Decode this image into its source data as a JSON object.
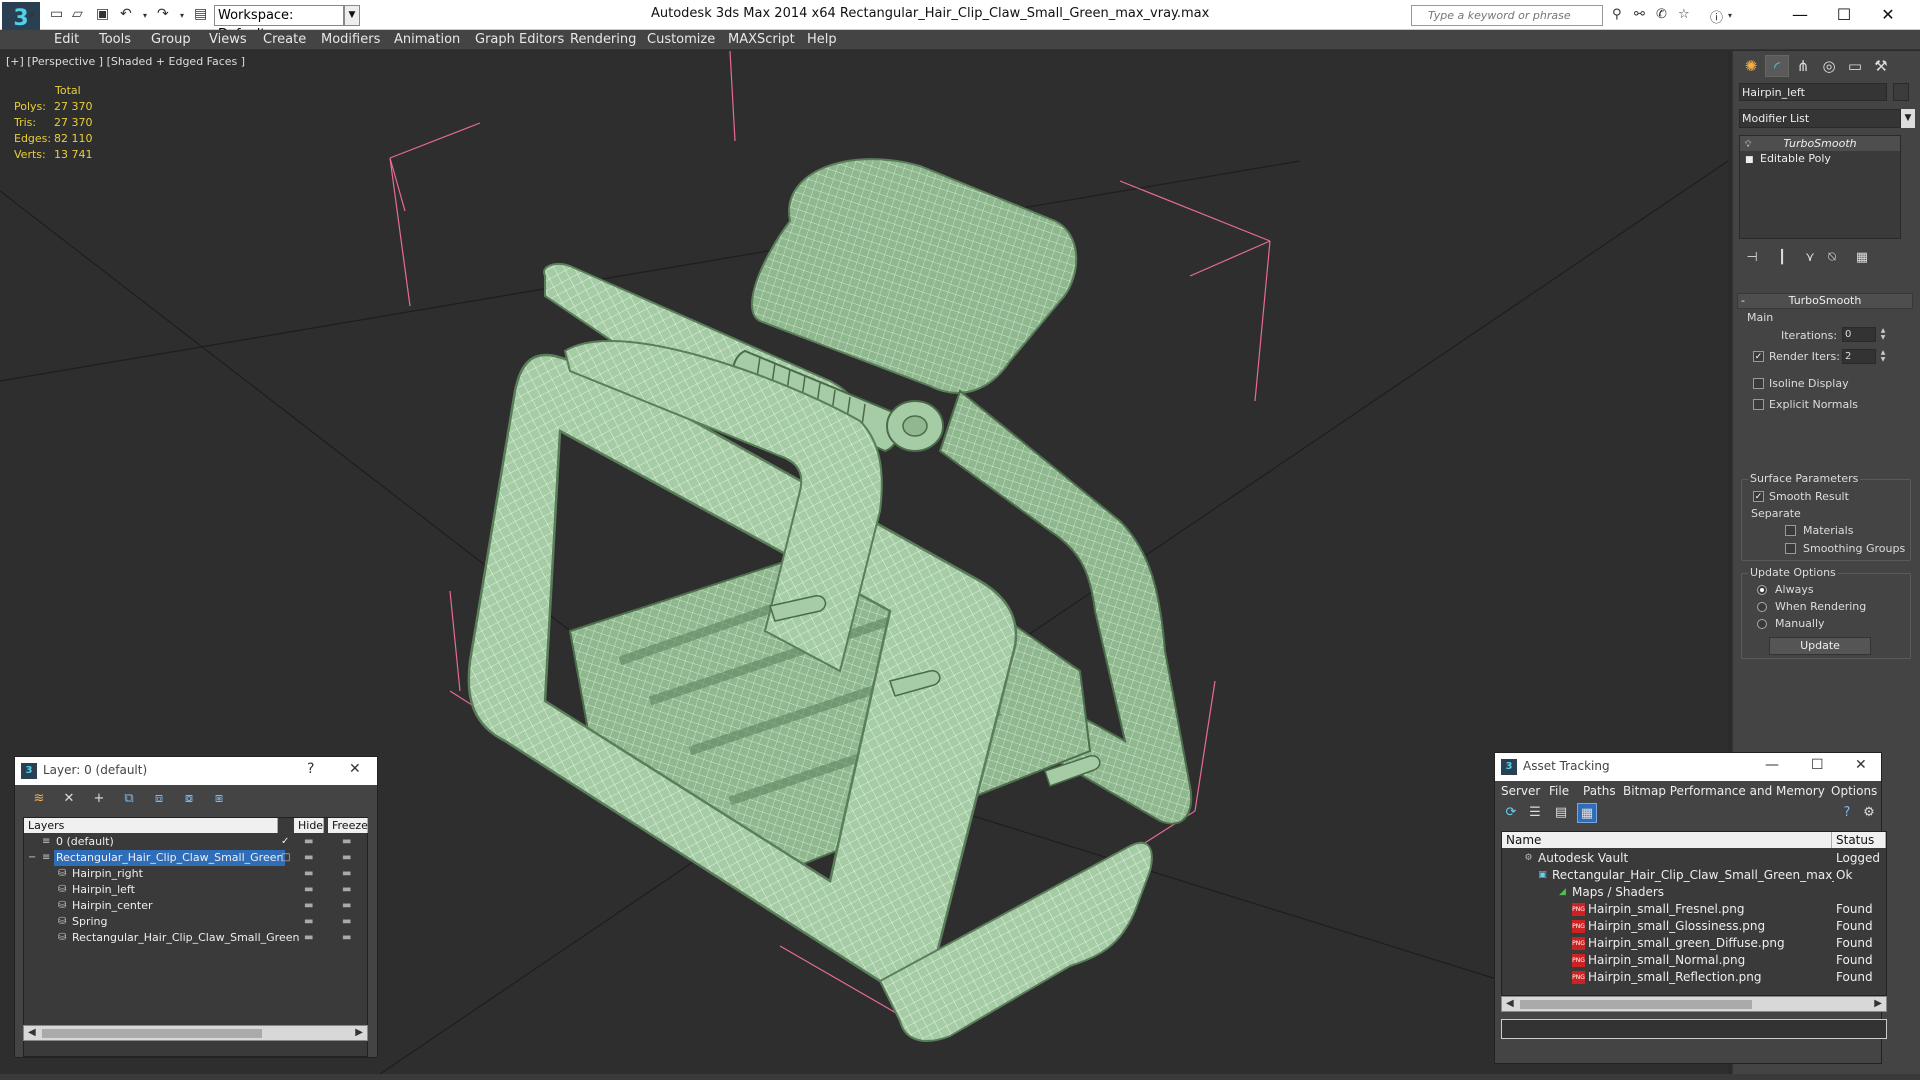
{
  "app": {
    "title": "Autodesk 3ds Max  2014 x64      Rectangular_Hair_Clip_Claw_Small_Green_max_vray.max",
    "workspace": "Workspace: Default",
    "search_placeholder": "Type a keyword or phrase"
  },
  "menu": [
    "Edit",
    "Tools",
    "Group",
    "Views",
    "Create",
    "Modifiers",
    "Animation",
    "Graph Editors",
    "Rendering",
    "Customize",
    "MAXScript",
    "Help"
  ],
  "viewport": {
    "label": "[+] [Perspective ] [Shaded + Edged Faces ]",
    "stats": {
      "header": "Total",
      "rows": [
        {
          "label": "Polys:",
          "value": "27 370"
        },
        {
          "label": "Tris:",
          "value": "27 370"
        },
        {
          "label": "Edges:",
          "value": "82 110"
        },
        {
          "label": "Verts:",
          "value": "13 741"
        }
      ]
    }
  },
  "command_panel": {
    "object_name": "Hairpin_left",
    "modifier_list": "Modifier List",
    "stack": [
      "TurboSmooth",
      "Editable Poly"
    ],
    "rollout": {
      "title": "TurboSmooth",
      "main": "Main",
      "iterations_label": "Iterations:",
      "iterations_value": "0",
      "render_iters_label": "Render Iters:",
      "render_iters_value": "2",
      "isoline": "Isoline Display",
      "explicit_normals": "Explicit Normals",
      "surface_params": "Surface Parameters",
      "smooth_result": "Smooth Result",
      "separate": "Separate",
      "materials": "Materials",
      "smoothing_groups": "Smoothing Groups",
      "update_options": "Update Options",
      "always": "Always",
      "when_rendering": "When Rendering",
      "manually": "Manually",
      "update_button": "Update"
    }
  },
  "layer_window": {
    "title": "Layer: 0 (default)",
    "help": "?",
    "columns": [
      "Layers",
      "Hide",
      "Freeze"
    ],
    "rows": [
      {
        "name": "0 (default)",
        "indent": 0,
        "selected": false,
        "check": "✓"
      },
      {
        "name": "Rectangular_Hair_Clip_Claw_Small_Green",
        "indent": 0,
        "selected": true,
        "check": "□"
      },
      {
        "name": "Hairpin_right",
        "indent": 1,
        "selected": false,
        "check": ""
      },
      {
        "name": "Hairpin_left",
        "indent": 1,
        "selected": false,
        "check": ""
      },
      {
        "name": "Hairpin_center",
        "indent": 1,
        "selected": false,
        "check": ""
      },
      {
        "name": "Spring",
        "indent": 1,
        "selected": false,
        "check": ""
      },
      {
        "name": "Rectangular_Hair_Clip_Claw_Small_Green",
        "indent": 1,
        "selected": false,
        "check": ""
      }
    ]
  },
  "asset_window": {
    "title": "Asset Tracking",
    "menu": [
      "Server",
      "File",
      "Paths",
      "Bitmap Performance and Memory",
      "Options"
    ],
    "columns": [
      "Name",
      "Status"
    ],
    "rows": [
      {
        "name": "Autodesk Vault",
        "status": "Logged",
        "indent": 0,
        "icon": "vault"
      },
      {
        "name": "Rectangular_Hair_Clip_Claw_Small_Green_max_vra...",
        "status": "Ok",
        "indent": 1,
        "icon": "max"
      },
      {
        "name": "Maps / Shaders",
        "status": "",
        "indent": 2,
        "icon": "maps"
      },
      {
        "name": "Hairpin_small_Fresnel.png",
        "status": "Found",
        "indent": 3,
        "icon": "png"
      },
      {
        "name": "Hairpin_small_Glossiness.png",
        "status": "Found",
        "indent": 3,
        "icon": "png"
      },
      {
        "name": "Hairpin_small_green_Diffuse.png",
        "status": "Found",
        "indent": 3,
        "icon": "png"
      },
      {
        "name": "Hairpin_small_Normal.png",
        "status": "Found",
        "indent": 3,
        "icon": "png"
      },
      {
        "name": "Hairpin_small_Reflection.png",
        "status": "Found",
        "indent": 3,
        "icon": "png"
      }
    ]
  },
  "colors": {
    "stats_text": "#e8d038",
    "model_fill": "#a3c9a3",
    "wire": "#ffffff",
    "bbox": "#ff6fa0",
    "selection": "#2f6db8"
  }
}
